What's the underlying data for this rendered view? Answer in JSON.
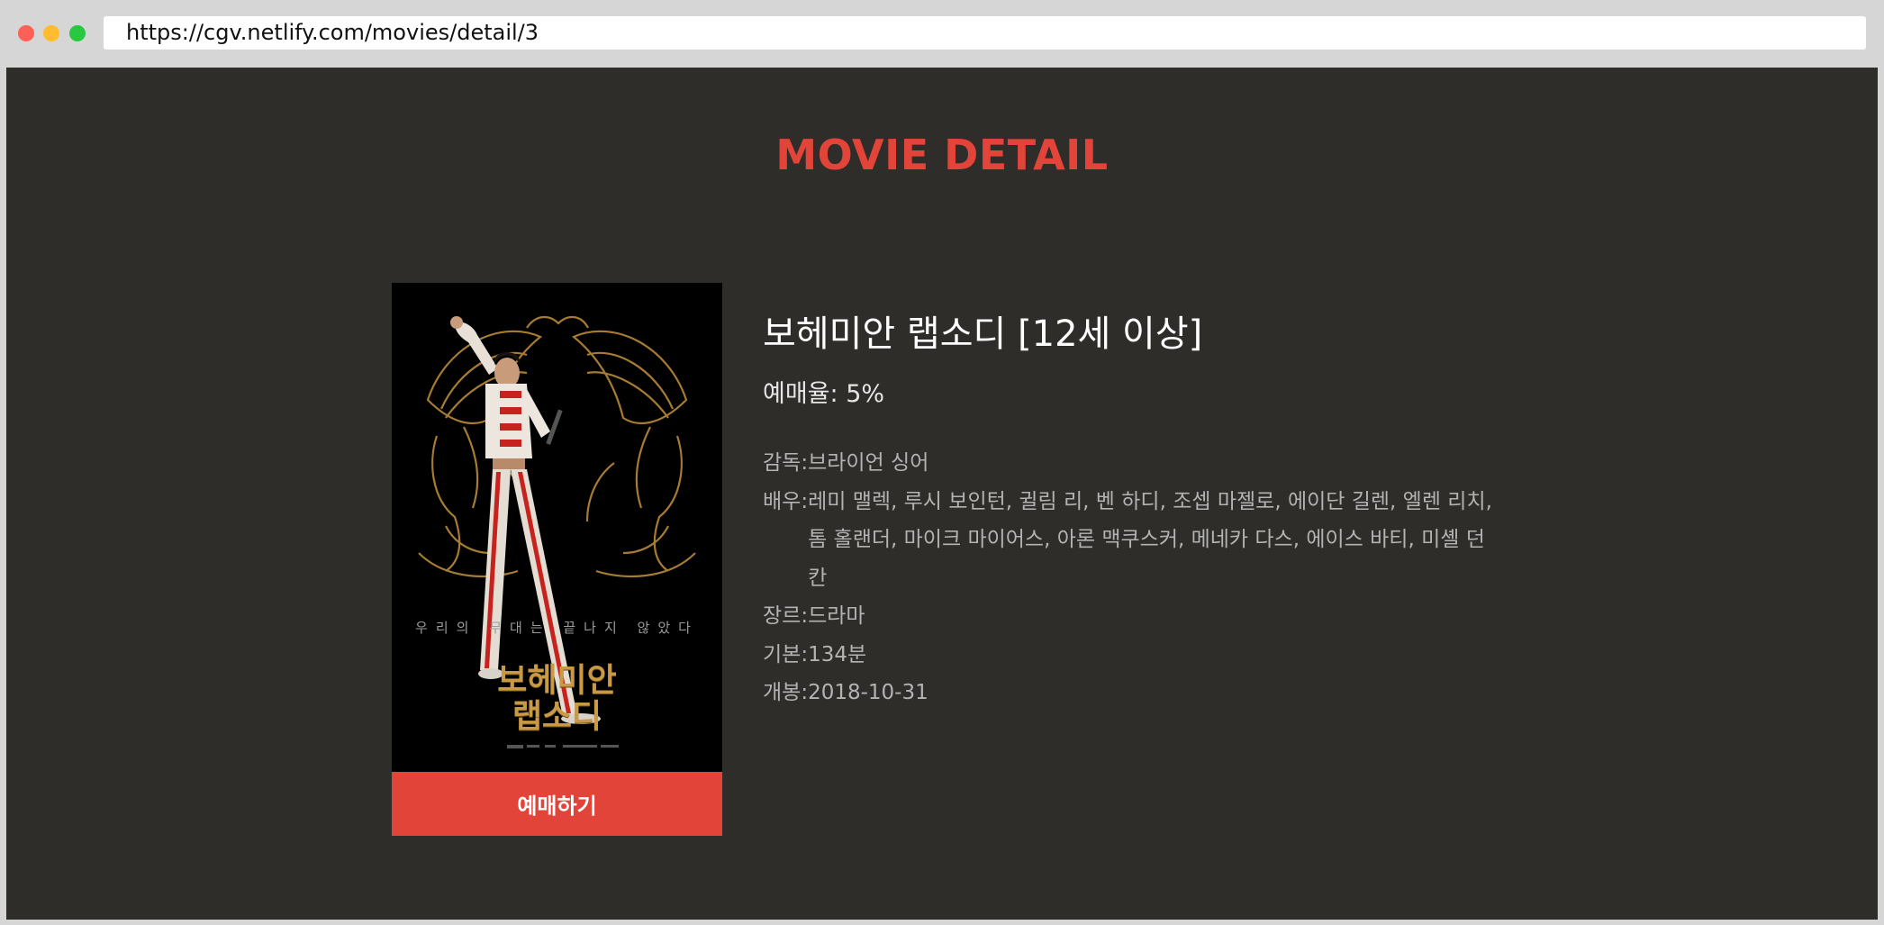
{
  "browser": {
    "url": "https://cgv.netlify.com/movies/detail/3"
  },
  "page": {
    "heading": "MOVIE DETAIL"
  },
  "poster": {
    "tagline": "우리의 무대는 끝나지 않았다",
    "logo_line1": "보헤미안",
    "logo_line2": "랩소디",
    "book_label": "예매하기"
  },
  "movie": {
    "title": "보헤미안 랩소디 [12세 이상]",
    "rate": "예매율: 5%",
    "director_label": "감독:",
    "director": " 브라이언 싱어",
    "cast_label": "배우:",
    "cast": " 레미 맬렉, 루시 보인턴, 귈림 리, 벤 하디, 조셉 마젤로, 에이단 길렌, 엘렌 리치, 톰 홀랜더, 마이크 마이어스, 아론 맥쿠스커, 메네카 다스, 에이스 바티, 미셸 던칸",
    "cast_line1": " 레미 맬렉, 루시 보인턴, 귈림 리, 벤 하디, 조셉 마젤로, 에이단 길렌,",
    "cast_line2": " 엘렌 리치, 톰 홀랜더, 마이크 마이어스, 아론 맥쿠스커, 메네카 다스,",
    "cast_line3": " 에이스 바티, 미셸 던칸",
    "genre_label": "장르:",
    "genre": " 드라마",
    "basic_label": "기본:",
    "basic": " 134분",
    "release_label": "개봉:",
    "release": " 2018-10-31"
  },
  "colors": {
    "accent": "#e3443a",
    "page_bg": "#2f2d29",
    "chrome_bg": "#d6d6d6"
  }
}
